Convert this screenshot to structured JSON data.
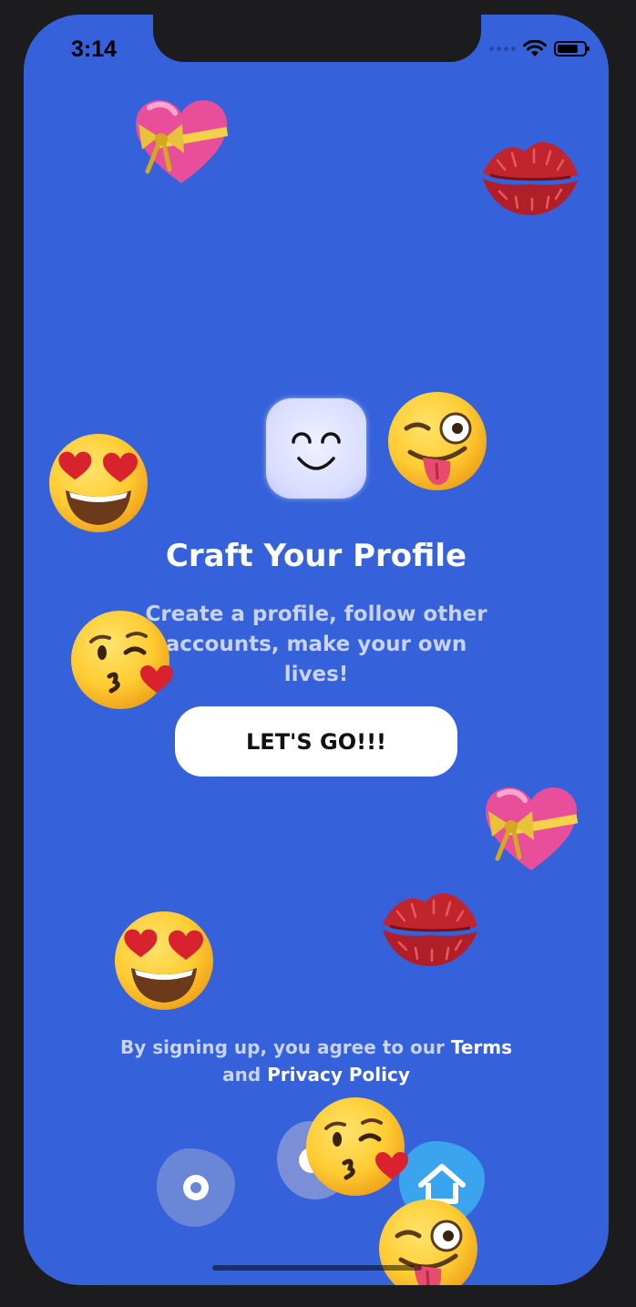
{
  "status_bar": {
    "time": "3:14"
  },
  "onboarding": {
    "title": "Craft Your Profile",
    "subtitle": "Create a profile, follow other accounts, make your own lives!",
    "cta_label": "LET'S GO!!!"
  },
  "legal": {
    "prefix": "By signing up, you agree to our",
    "terms_label": "Terms",
    "connector": "and",
    "privacy_label": "Privacy Policy"
  },
  "icons": {
    "status": [
      "signal-icon",
      "wifi-icon",
      "battery-icon"
    ],
    "decorations": [
      "heart-with-ribbon-icon",
      "kiss-mark-icon",
      "smiling-face-heart-eyes-icon",
      "face-blowing-kiss-icon",
      "winking-face-tongue-icon"
    ],
    "bottom": [
      "circle-dot-icon",
      "home-icon"
    ]
  },
  "colors": {
    "background": "#3561DB",
    "button_bg": "#FFFFFF",
    "button_text": "#111111",
    "muted_text": "#C9D3F2"
  }
}
